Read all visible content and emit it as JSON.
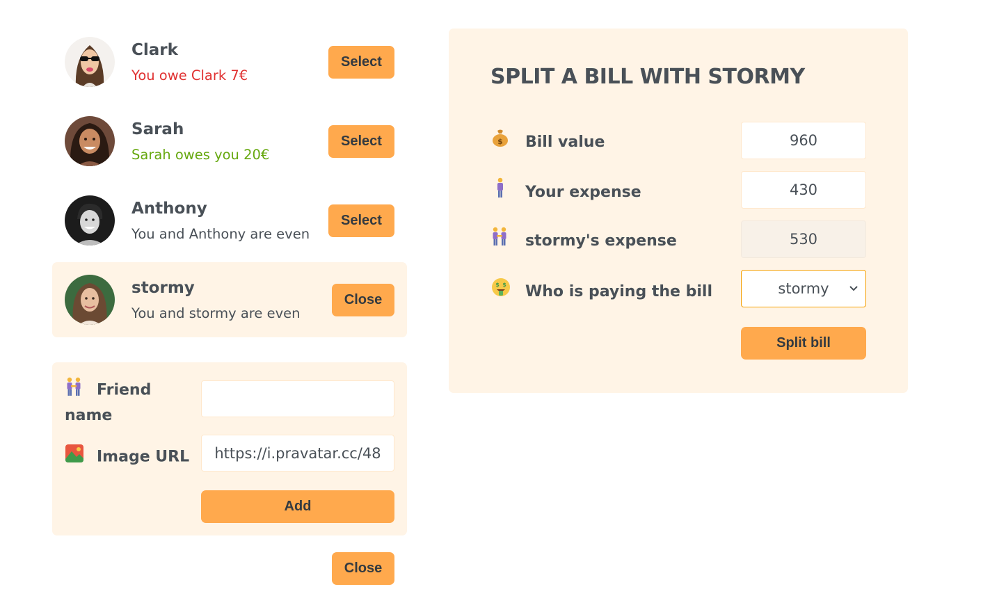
{
  "friends": [
    {
      "name": "Clark",
      "status": "You owe Clark 7€",
      "status_type": "owe",
      "button": "Select"
    },
    {
      "name": "Sarah",
      "status": "Sarah owes you 20€",
      "status_type": "owed",
      "button": "Select"
    },
    {
      "name": "Anthony",
      "status": "You and Anthony are even",
      "status_type": "even",
      "button": "Select"
    },
    {
      "name": "stormy",
      "status": "You and stormy are even",
      "status_type": "even",
      "button": "Close"
    }
  ],
  "add_friend": {
    "friend_name_label": "Friend name",
    "friend_name_icon": "people-holding-hands-icon",
    "friend_name_value": "",
    "image_url_label": "Image URL",
    "image_url_icon": "picture-landscape-icon",
    "image_url_value": "https://i.pravatar.cc/48",
    "add_button": "Add"
  },
  "close_button": "Close",
  "split": {
    "title": "SPLIT A BILL WITH STORMY",
    "bill_value_label": "Bill value",
    "bill_value_icon": "money-bag-icon",
    "bill_value": "960",
    "your_expense_label": "Your expense",
    "your_expense_icon": "person-standing-icon",
    "your_expense": "430",
    "friend_expense_label": "stormy's expense",
    "friend_expense_icon": "people-holding-hands-icon",
    "friend_expense": "530",
    "payer_label": "Who is paying the bill",
    "payer_icon": "money-mouth-face-icon",
    "payer_selected": "stormy",
    "submit_button": "Split bill"
  },
  "colors": {
    "accent": "#ffa94d",
    "panel_bg": "#fff4e6",
    "text": "#495057",
    "owe": "#e03131",
    "owed": "#66a80f"
  }
}
